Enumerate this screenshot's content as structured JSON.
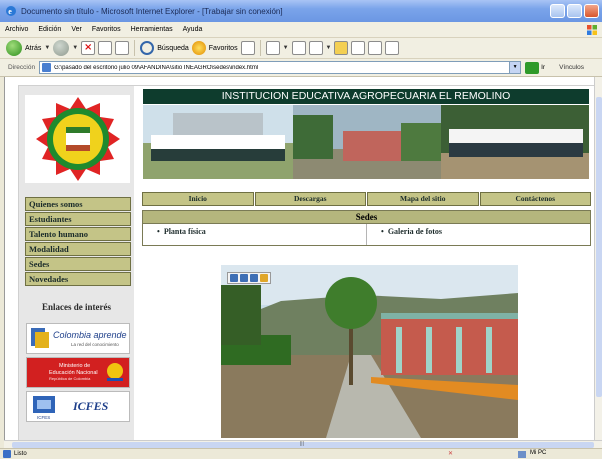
{
  "window": {
    "title": "Documento sin título - Microsoft Internet Explorer - [Trabajar sin conexión]"
  },
  "menubar": {
    "items": [
      "Archivo",
      "Edición",
      "Ver",
      "Favoritos",
      "Herramientas",
      "Ayuda"
    ]
  },
  "toolbar": {
    "back_label": "Atrás",
    "search_label": "Búsqueda",
    "favorites_label": "Favoritos"
  },
  "address": {
    "label": "Dirección",
    "value": "G:\\pasado del escritorio julio 09\\AFANDINA\\sitio INEAGRO\\sedes\\index.html",
    "go_label": "Ir",
    "links_label": "Vínculos"
  },
  "page": {
    "banner_title": "INSTITUCION EDUCATIVA AGROPECUARIA EL REMOLINO",
    "side_menu": [
      "Quienes somos",
      "Estudiantes",
      "Talento humano",
      "Modalidad",
      "Sedes",
      "Novedades"
    ],
    "enlaces_title": "Enlaces de interés",
    "ext_links": {
      "colombia_aprende": "Colombia aprende",
      "colombia_aprende_sub": "La red del conocimiento",
      "men_line1": "Ministerio de",
      "men_line2": "Educación Nacional",
      "men_line3": "República de Colombia",
      "icfes": "ICFES",
      "icfes_small": "ICFES"
    },
    "nav": [
      "Inicio",
      "Descargas",
      "Mapa del sitio",
      "Contáctenos"
    ],
    "sedes": {
      "header": "Sedes",
      "links": [
        "Planta física",
        "Galeria de fotos"
      ]
    }
  },
  "status": {
    "text": "Listo",
    "zone": "Mi PC"
  }
}
